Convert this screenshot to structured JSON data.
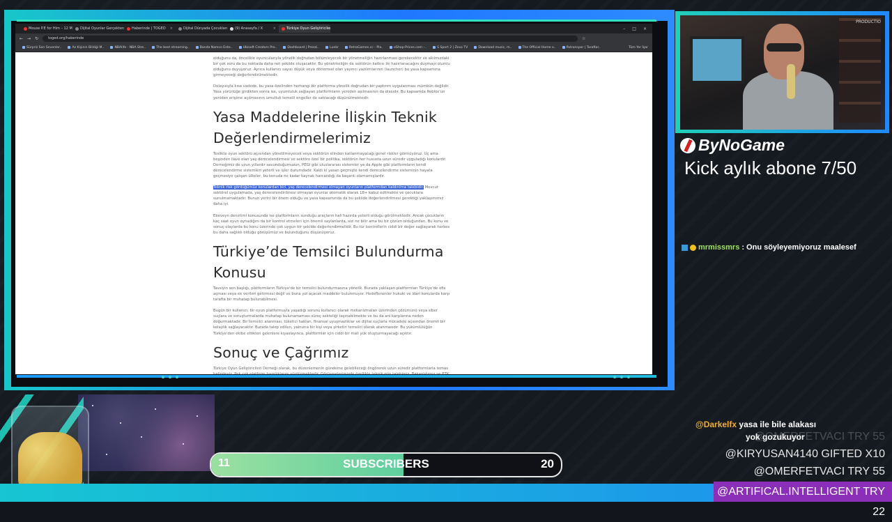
{
  "browser": {
    "tabs": [
      "Mouse P.E for Him – 12 Minutes",
      "Dijital Oyunlar Gerçekten Yasal",
      "Haberinde | TOGED",
      "Dijital Dünyada Çocukların Gü",
      "(9) Anasayfa / X",
      "Türkiye Oyun Geliştiricileri Der"
    ],
    "url": "toged.org/haberinde",
    "bookmarks": [
      "Sürpriz Son Sevenler..",
      "Az Kişinin Bildiği M..",
      "NBAlife - NBA Stre..",
      "The best streaming..",
      "Banda Namco Ente..",
      "Ubisoft Creators Pro..",
      "Dashboard | Prezzi..",
      "Lunkr",
      "RetroGames.cc - Pla..",
      "eShop-Prices.com -..",
      "S Sport 2 | Zeus TV",
      "Download music, m..",
      "The Official Home o..",
      "Patronspor | Taraftar.."
    ],
    "bookmarks_right": "Tüm Yer İşar"
  },
  "article": {
    "p1": "olduğunu da, öncelikle oyuncularıyla yönelik doğrudan bölümleyecek bir yönetmeliğin hazırlanması gerekecektir ve akılmızdaki bir çok soru da bu noktada daha net şekilde oluşacaktır. Bu yönetmeliğin de sektörün katkısı ile hazırlanacağını duymayı olumlu olduğunu duyuyoruz. Ayrıca kullanıcı sayısı düşük veya dönemsel olan yayıncı yazılımlarının (launcher) bu yasa kapsamına girmeyeceği değerlendirilmektedir.",
    "p2": "Dolayısıyla kısa vadede, bu yasa özelinden herhangi bir platforma yönelik doğrudan bir yaptırım uygulanması mümkün değildir. Yasa yürürlüğe girdikten sonra ise, uyumluluk sağlayan platformların yeniden aşılmasının da olasıdır. Bu kapsamda Roblox'un yeniden erişime açılmasının umutluk temelli engeller de satılacağı düşünülmektedir.",
    "h1": "Yasa Maddelerine İlişkin Teknik Değerlendirmelerimiz",
    "p3": "Teslikte oyun sektörü açısından yönetilmeyecek veya sektörün elinden katlanmayacağı genel riskler görmüyoruz. Uç ama beşinden ilave olan yaş derecelendirmesi ve sektöre özel bir politika, sektörün her hususta uzun süredir uyguladığı konulardır. Derneğimiz de uzun yıllardır savunduğumuzun, PEGI gibi uluslararası sistemler ya da Apple gibi platformların kendi derecelendirme sistemleri yeterli ve işler durumdadır. Kaldı ki yasan geçmişte kendi derecelendirme sisteminin hayata geçmesiye çalışan ülkeler, bu konuda ne kadar kaynak harcandığı da başarılı olamamışlardır.",
    "p4_highlight": "Teknik risk gördüğümüz konulardan biri, yaş derecelendirmesi olmayan oyunların platformdan kaldırılma talebidir.",
    "p4_rest": " Mevcut sektörel uygulamada, yaş derecelendirilmesi olmayan oyunlar otomatik olarak 18+ kabul edilmekte ve çocuklara sunulmamaktadır. Bunun yerini bir önem olduğu ve yasa kapsamında da bu şekilde değerlendirilmesi gerektiği yaklaşımımız daha iyi.",
    "p5": "Ebeveyn denetimi konusunda ise platformların sunduğu araçların hali hazırda yeterli olduğu görülmektedir. Ancak çocukların kaç saat oyun oynadığını da bir kontrol etmeleri için önemli saylanlarda, sizi ne bilir ama bu bir çözüm olduğundan. Bu konu ve sonuç olaylarda bu konu üzerinde çok uygun bir şekilde değerlendirmelidir. Bu tür kontrollerin ciddi bir değer sağlayarak herkes bu daha sağlıklı olduğu görüşümüz ve bulunduğunu düşünüyoruz.",
    "h2": "Türkiye’de Temsilci Bulundurma Konusu",
    "p6": "Tavsiyin sen başlığı, platformların Türkiye'de bir temsilci bulundurmasına yönelik. Burada yaklaşan platformları Türkiye'de ofis açması veya ek verileri getirmesi değil ve buna yol açacak maddeler bulunmuyor. Hedeflenenler hukuki ve idari konularda karşı tarafta bir muhatap bulunabilmesi.",
    "p7": "Bugün bir kullanıcı, bir oyun platformuyla yaşadığı sorunu kullanıcı olarak mekanizmaları üzerinden çözümünü veya siber suçlara ve soruşturmalarda muhatap bulunamaması süreç sekteliği taşınabilmekte ve bu da ani karşılarına neden doğurmaktadır. Bir temsilci atanması; tüketici hakları, finansal uyuşmazlıklar ve dijital suçlarla mücadele açısından önemli bir kolaylık sağlayacaktır. Burada talep edilen, yalnızca bir kişi veya şirketin temsilci olarak atanmasıdır. Bu yükümlülüğün Türkiye'den ekibe ettikleri gelenlere kıyaslayınca, platformlar için ciddi bir mali yük oluşturmayacağı açıktır.",
    "h3": "Sonuç ve Çağrımız",
    "p8": "Türkiye Oyun Geliştiricileri Derneği olarak, bu düzenlemenin gündeme gelebileceği öngörerek uzun süredir platformlarla temas halindeyiz. Pek çok platform hazırlıklarını sürdürmektedir. Görüşmelerimizde özellikle teknik gün talebimiz. Bakanlığımız ve BTK tarafından yapıcı ve olumlu karşılanmasından memnuniyet duyuyoruz."
  },
  "overlay": {
    "brand": "ByNoGame",
    "kick_goal": "Kick aylık abone 7/50",
    "chat": {
      "user": "mrmissmrs",
      "message": ": Onu söyleyemiyoruz maalesef"
    },
    "subscribers": {
      "label": "SUBSCRIBERS",
      "current": "11",
      "goal": "20",
      "progress": 0.55
    },
    "gift_chat": {
      "user": "@Darkelfx",
      "line1": " yasa ile bile alakası",
      "line2": "yok gozukuyor"
    },
    "gifts": [
      {
        "text": "@OMERFETVACI  TRY 55",
        "faded": true
      },
      {
        "text": "@KIRYUSAN4140  GIFTED X10",
        "faded": false
      },
      {
        "text": "@OMERFETVACI  TRY 55",
        "faded": false
      }
    ],
    "highlight_gift": "@ARTIFICAL.INTELLIGENT  TRY 22",
    "cam_text": "PRODUCTIO"
  },
  "colors": {
    "accent_teal": "#1ed0c0",
    "accent_blue": "#1e88ff",
    "highlight_purple": "#8b2fb8"
  }
}
